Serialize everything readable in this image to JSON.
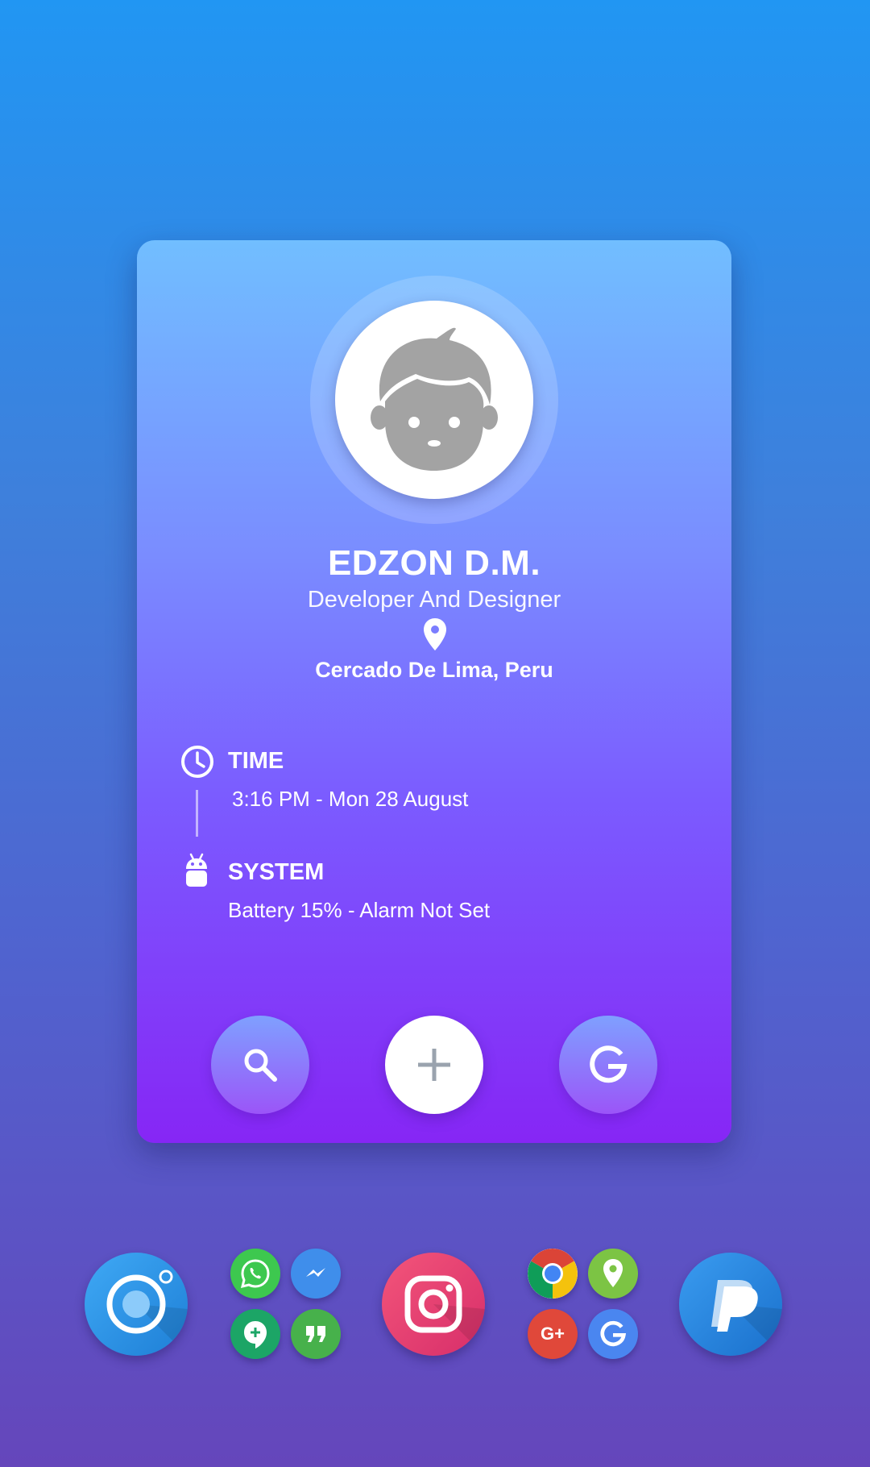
{
  "profile": {
    "name": "EDZON D.M.",
    "role": "Developer And Designer",
    "location": "Cercado De Lima, Peru",
    "avatar_icon": "boy-face-avatar-icon"
  },
  "time_section": {
    "title": "TIME",
    "value": "3:16 PM - Mon 28 August",
    "icon": "clock-icon"
  },
  "system_section": {
    "title": "SYSTEM",
    "value": "Battery 15% - Alarm Not Set",
    "icon": "android-icon"
  },
  "card_actions": [
    {
      "name": "search",
      "icon": "search-icon"
    },
    {
      "name": "add",
      "icon": "plus-icon"
    },
    {
      "name": "google",
      "icon": "google-g-icon"
    }
  ],
  "dock": {
    "apps": [
      {
        "name": "camera",
        "icon": "camera-icon"
      },
      {
        "name": "whatsapp",
        "icon": "whatsapp-icon"
      },
      {
        "name": "messenger",
        "icon": "messenger-icon"
      },
      {
        "name": "hangouts",
        "icon": "hangouts-icon"
      },
      {
        "name": "quotes-chat",
        "icon": "quotes-icon"
      },
      {
        "name": "instagram",
        "icon": "instagram-icon"
      },
      {
        "name": "chrome",
        "icon": "chrome-icon"
      },
      {
        "name": "maps",
        "icon": "map-pin-icon"
      },
      {
        "name": "google-plus",
        "icon": "google-plus-icon",
        "label": "G+"
      },
      {
        "name": "google",
        "icon": "google-g-icon"
      },
      {
        "name": "paypal",
        "icon": "paypal-icon"
      }
    ]
  },
  "colors": {
    "background_top": "#2196F3",
    "background_bottom": "#6546BB",
    "card_top": "#71BEFF",
    "card_bottom": "#8626F5",
    "text": "#FFFFFF"
  }
}
